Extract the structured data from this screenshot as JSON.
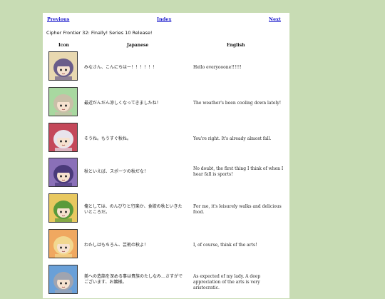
{
  "nav": {
    "previous": "Previous",
    "index": "Index",
    "next": "Next"
  },
  "title": "Cipher Frontier 32: Finally! Series 10 Release!",
  "headers": {
    "icon": "Icon",
    "japanese": "Japanese",
    "english": "English"
  },
  "rows": [
    {
      "japanese": "みなさん、こんにちはー！！！！！！",
      "english": "Hello everyooone!!!!!!",
      "bg": "#e8d8b0",
      "hair": "#6a5d8a"
    },
    {
      "japanese": "最近だんだん涼しくなってきましたね！",
      "english": "The weather's been cooling down lately!",
      "bg": "#a8d8a0",
      "hair": "#c9bfa8"
    },
    {
      "japanese": "そうね。もうすぐ秋ね。",
      "english": "You're right. It's already almost fall.",
      "bg": "#c4485a",
      "hair": "#e8e4ec"
    },
    {
      "japanese": "秋といえば、スポーツの秋だな！",
      "english": "No doubt, the first thing I think of when I hear fall is sports!",
      "bg": "#8a70b8",
      "hair": "#4a3a7a"
    },
    {
      "japanese": "俺としては、のんびりと行楽か、食欲の秋といきたいところだ。",
      "english": "For me, it's leisurely walks and delicious food.",
      "bg": "#e8c860",
      "hair": "#5a9a3a"
    },
    {
      "japanese": "わたしはもちろん、芸術の秋よ！",
      "english": "I, of course, think of the arts!",
      "bg": "#f0a860",
      "hair": "#f2d890"
    },
    {
      "japanese": "美への造詣を深める事は貴族のたしなみ…さすがでございます、お嬢様。",
      "english": "As expected of my lady. A deep appreciation of the arts is very aristocratic.",
      "bg": "#6aa0d8",
      "hair": "#a0a4b0"
    }
  ]
}
